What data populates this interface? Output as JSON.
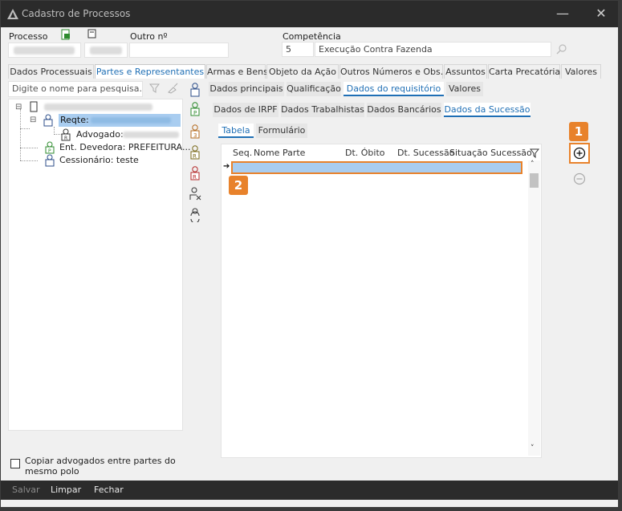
{
  "window": {
    "title": "Cadastro de Processos",
    "minimize_glyph": "—",
    "close_glyph": "✕"
  },
  "header": {
    "processo_label": "Processo",
    "outro_label": "Outro nº",
    "competencia_label": "Competência",
    "competencia_code": "5",
    "competencia_desc": "Execução Contra Fazenda"
  },
  "main_tabs": [
    {
      "label": "Dados Processuais",
      "active": false
    },
    {
      "label": "Partes e Representantes",
      "active": true
    },
    {
      "label": "Armas e Bens",
      "active": false
    },
    {
      "label": "Objeto da Ação",
      "active": false
    },
    {
      "label": "Outros Números e Obs.",
      "active": false
    },
    {
      "label": "Assuntos",
      "active": false
    },
    {
      "label": "Carta Precatória",
      "active": false
    },
    {
      "label": "Valores",
      "active": false
    }
  ],
  "left": {
    "search_placeholder": "Digite o nome para pesquisa...",
    "tree": {
      "reqte": "Reqte:",
      "advogado": "Advogado:",
      "ent_devedora": "Ent. Devedora: PREFEITURA...",
      "cessionario": "Cessionário: teste"
    },
    "copy_checkbox_label": "Copiar advogados entre partes do mesmo polo"
  },
  "sub_tabs_1": [
    {
      "label": "Dados principais",
      "active": false
    },
    {
      "label": "Qualificação",
      "active": false
    },
    {
      "label": "Dados do requisitório",
      "active": true
    },
    {
      "label": "Valores",
      "active": false
    }
  ],
  "sub_tabs_2": [
    {
      "label": "Dados de IRPF",
      "active": false
    },
    {
      "label": "Dados Trabalhistas",
      "active": false
    },
    {
      "label": "Dados Bancários",
      "active": false
    },
    {
      "label": "Dados da Sucessão",
      "active": true
    }
  ],
  "view_tabs": [
    {
      "label": "Tabela",
      "active": true
    },
    {
      "label": "Formulário",
      "active": false
    }
  ],
  "grid": {
    "columns": [
      "Seq.",
      "Nome Parte",
      "Dt. Óbito",
      "Dt. Sucessão",
      "Situação Sucessão"
    ],
    "row_indicator": "➔"
  },
  "callouts": {
    "one": "1",
    "two": "2"
  },
  "footer": {
    "salvar": "Salvar",
    "limpar": "Limpar",
    "fechar": "Fechar"
  },
  "colors": {
    "accent": "#1f6fb5",
    "callout": "#e8822b",
    "selection": "#a9cdf0"
  }
}
